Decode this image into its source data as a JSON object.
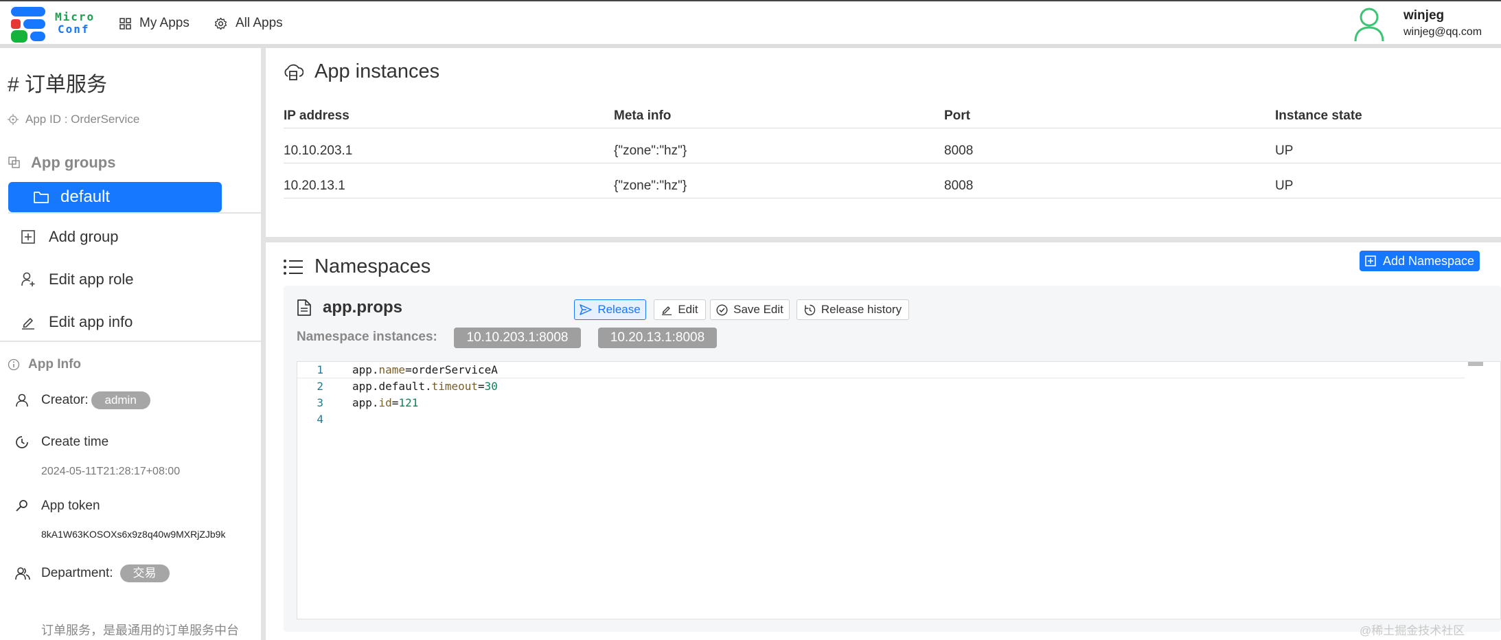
{
  "header": {
    "logo_text_line1": "Micro",
    "logo_text_line2": "Conf",
    "nav": [
      {
        "label": "My Apps",
        "icon": "grid-icon"
      },
      {
        "label": "All Apps",
        "icon": "gear-icon"
      }
    ],
    "user": {
      "name": "winjeg",
      "email": "winjeg@qq.com"
    }
  },
  "sidebar": {
    "app_title": "# 订单服务",
    "app_id": "App ID : OrderService",
    "groups_heading": "App groups",
    "selected_group": "default",
    "actions": [
      {
        "label": "Add group",
        "icon": "plus-square-icon"
      },
      {
        "label": "Edit app role",
        "icon": "user-add-icon"
      },
      {
        "label": "Edit app info",
        "icon": "edit-icon"
      }
    ],
    "info_heading": "App Info",
    "creator_label": "Creator:",
    "creator_value": "admin",
    "create_time_label": "Create time",
    "create_time_value": "2024-05-11T21:28:17+08:00",
    "token_label": "App token",
    "token_value": "8kA1W63KOSOXs6x9z8q40w9MXRjZJb9k",
    "department_label": "Department:",
    "department_value": "交易",
    "description": "订单服务，是最通用的订单服务中台"
  },
  "instances": {
    "title": "App instances",
    "columns": [
      "IP address",
      "Meta info",
      "Port",
      "Instance state"
    ],
    "rows": [
      [
        "10.10.203.1",
        "{\"zone\":\"hz\"}",
        "8008",
        "UP"
      ],
      [
        "10.20.13.1",
        "{\"zone\":\"hz\"}",
        "8008",
        "UP"
      ]
    ]
  },
  "namespaces": {
    "title": "Namespaces",
    "add_button": "Add Namespace",
    "file_name": "app.props",
    "buttons": {
      "release": "Release",
      "edit": "Edit",
      "save_edit": "Save Edit",
      "release_history": "Release history"
    },
    "instances_label": "Namespace instances:",
    "instance_chips": [
      "10.10.203.1:8008",
      "10.20.13.1:8008"
    ],
    "code": {
      "line_numbers": [
        "1",
        "2",
        "3",
        "4"
      ],
      "lines": [
        {
          "parts": [
            [
              "app.",
              "k"
            ],
            [
              "name",
              "p"
            ],
            [
              "=orderServiceA",
              "k"
            ]
          ]
        },
        {
          "parts": [
            [
              "app.default.",
              "k"
            ],
            [
              "timeout",
              "p"
            ],
            [
              "=",
              "k"
            ],
            [
              "30",
              "n"
            ]
          ]
        },
        {
          "parts": [
            [
              "app.",
              "k"
            ],
            [
              "id",
              "p"
            ],
            [
              "=",
              "k"
            ],
            [
              "121",
              "n"
            ]
          ]
        },
        {
          "parts": []
        }
      ]
    }
  },
  "watermark": "@稀土掘金技术社区",
  "colors": {
    "primary": "#1677ff",
    "chip_gray": "#a6a6a6",
    "prop_key": "#795e26",
    "number": "#098658",
    "user_icon": "#3bc474"
  }
}
